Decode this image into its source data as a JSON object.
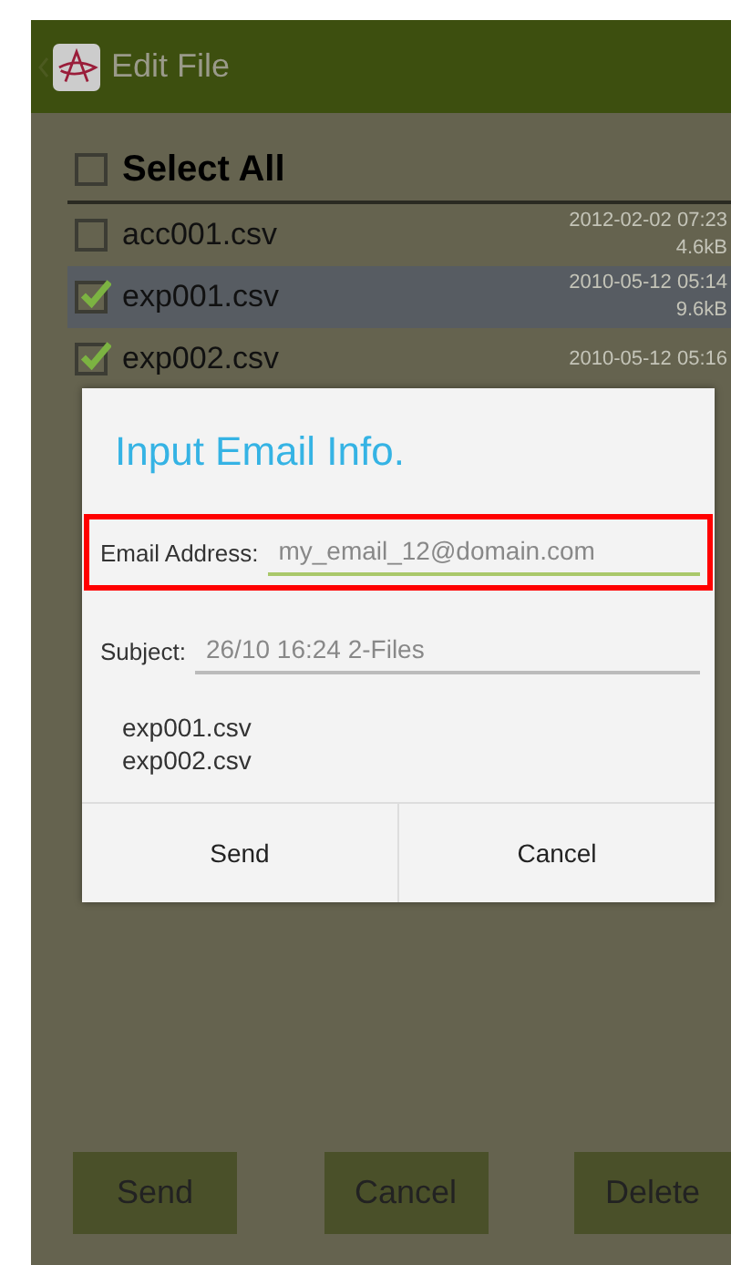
{
  "header": {
    "title": "Edit File"
  },
  "select_all": {
    "label": "Select All",
    "checked": false
  },
  "files": [
    {
      "name": "acc001.csv",
      "date": "2012-02-02 07:23",
      "size": "4.6kB",
      "checked": false,
      "selected": false
    },
    {
      "name": "exp001.csv",
      "date": "2010-05-12 05:14",
      "size": "9.6kB",
      "checked": true,
      "selected": true
    },
    {
      "name": "exp002.csv",
      "date": "2010-05-12 05:16",
      "checked": true,
      "selected": false
    }
  ],
  "dialog": {
    "title": "Input Email Info.",
    "email": {
      "label": "Email Address:",
      "value": "my_email_12@domain.com",
      "highlighted": true
    },
    "subject": {
      "label": "Subject:",
      "value": "26/10 16:24 2-Files"
    },
    "attachments": [
      "exp001.csv",
      "exp002.csv"
    ],
    "buttons": [
      "Send",
      "Cancel"
    ]
  },
  "bottom_buttons": [
    "Send",
    "Cancel",
    "Delete"
  ]
}
